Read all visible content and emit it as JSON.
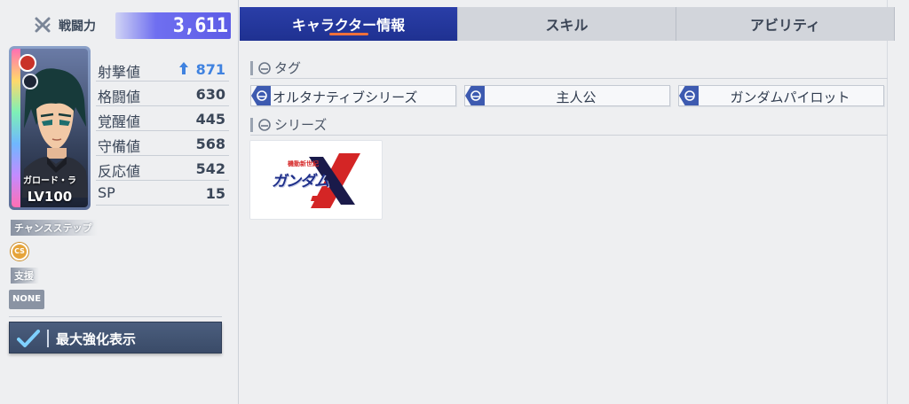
{
  "power": {
    "label": "戦闘力",
    "value": "3,611"
  },
  "card": {
    "name": "ガロード・ラ",
    "level": "LV100"
  },
  "stats": [
    {
      "name": "射撃値",
      "value": "871",
      "boosted": true
    },
    {
      "name": "格闘値",
      "value": "630",
      "boosted": false
    },
    {
      "name": "覚醒値",
      "value": "445",
      "boosted": false
    },
    {
      "name": "守備値",
      "value": "568",
      "boosted": false
    },
    {
      "name": "反応値",
      "value": "542",
      "boosted": false
    },
    {
      "name": "SP",
      "value": "15",
      "boosted": false
    }
  ],
  "chance_step": {
    "label": "チャンスステップ",
    "icon_text": "CS"
  },
  "support": {
    "label": "支援",
    "value": "NONE"
  },
  "max_toggle": {
    "label": "最大強化表示",
    "checked": true
  },
  "tabs": [
    {
      "label": "キャラクター情報",
      "active": true
    },
    {
      "label": "スキル",
      "active": false
    },
    {
      "label": "アビリティ",
      "active": false
    }
  ],
  "tags_section": {
    "title": "タグ"
  },
  "tags": [
    {
      "label": "オルタナティブシリーズ"
    },
    {
      "label": "主人公"
    },
    {
      "label": "ガンダムパイロット"
    }
  ],
  "series_section": {
    "title": "シリーズ"
  },
  "series_logo": {
    "top_text": "機動新世紀",
    "main_text": "ガンダム",
    "letter": "X"
  },
  "colors": {
    "accent_blue": "#1f3191",
    "tab_underline": "#f0703a",
    "boost_blue": "#3f82e0",
    "power_purple": "#5d5ce6"
  }
}
